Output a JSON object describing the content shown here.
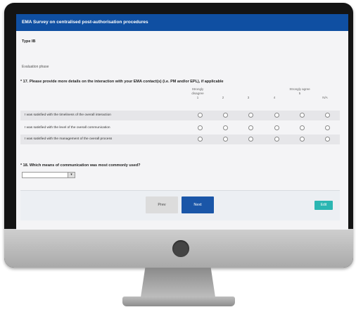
{
  "survey": {
    "title": "EMA Survey on centralised post-authorisation procedures",
    "type": "Type IB",
    "phase": "Evaluation phase"
  },
  "q17": {
    "text": "* 17. Please provide more details on the interaction with your EMA contact(s) (i.e. PM and/or EPL), if applicable",
    "scale": {
      "strongly_disagree": "Strongly disagree",
      "strongly_agree": "Strongly agree",
      "c1": "1",
      "c2": "2",
      "c3": "3",
      "c4": "4",
      "c5": "5",
      "na": "N/A"
    },
    "rows": [
      "I was satisfied with the timeliness of the overall interaction",
      "I was satisfied with the level of the overall communication",
      "I was satisfied with the management of the overall process"
    ]
  },
  "q18": {
    "text": "* 18. Which means of communication was most commonly used?",
    "selected": ""
  },
  "buttons": {
    "prev": "Prev",
    "next": "Next",
    "edit": "Edit"
  },
  "colors": {
    "title_bar": "#0f4fa2",
    "next_button": "#1a56a8",
    "edit_button": "#2bb6b2"
  }
}
